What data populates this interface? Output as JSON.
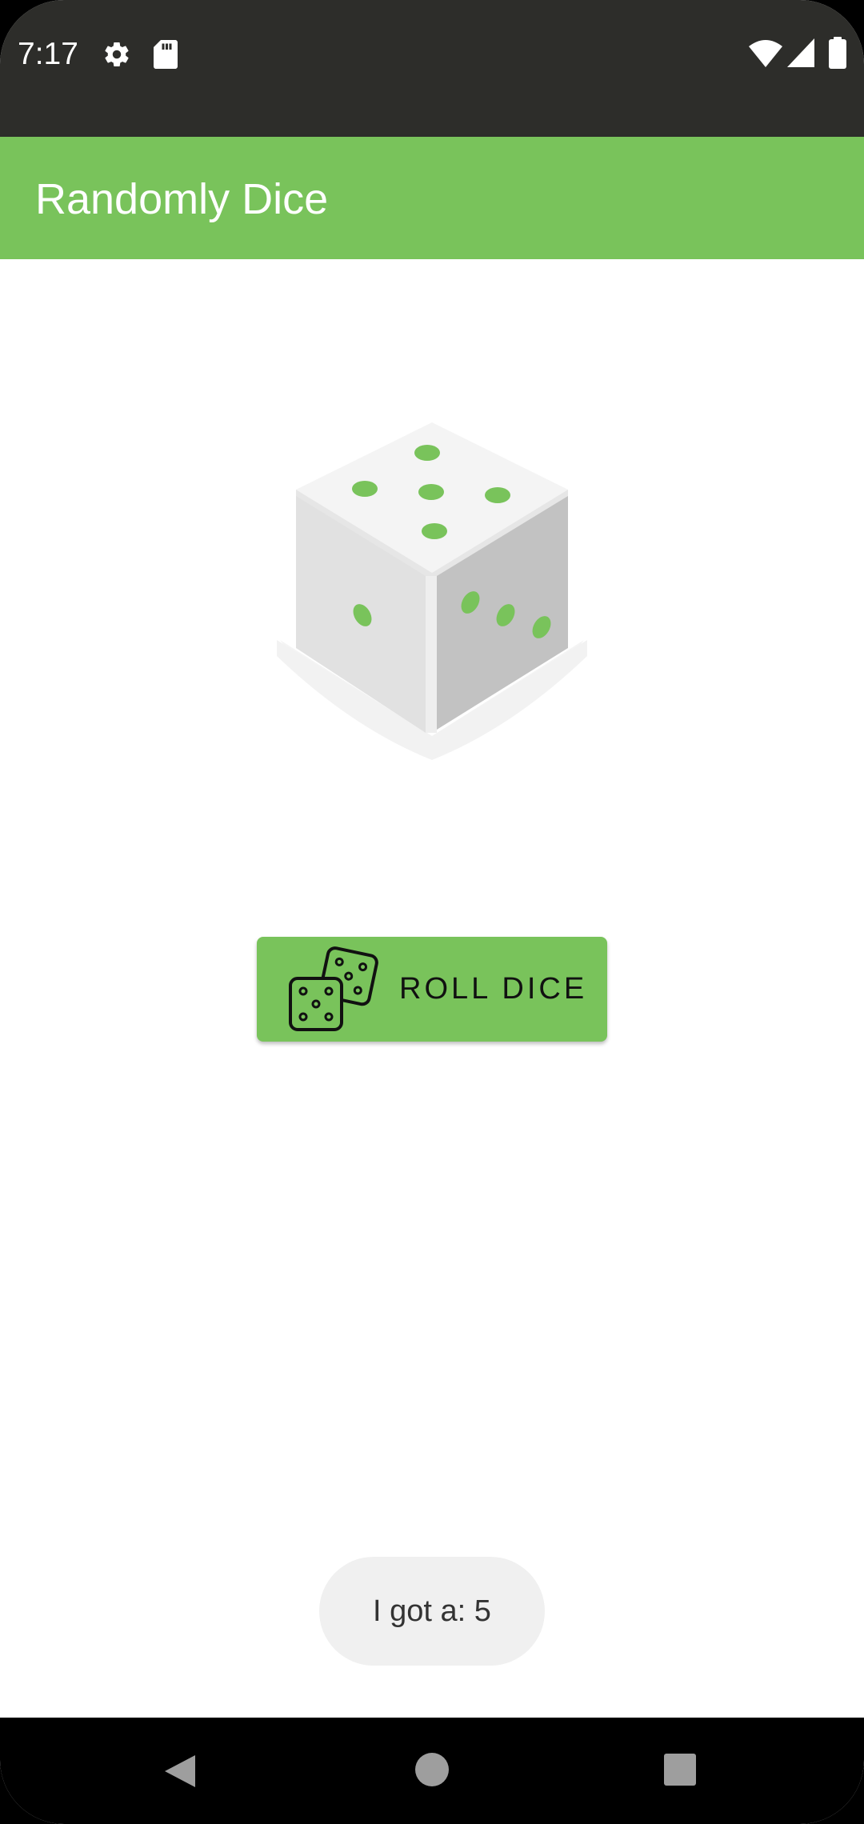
{
  "status_bar": {
    "time": "7:17",
    "icons": [
      "gear-icon",
      "sd-card-icon",
      "wifi-icon",
      "cell-signal-icon",
      "battery-icon"
    ],
    "background": "#2d2d2a"
  },
  "app_bar": {
    "title": "Randomly Dice",
    "color": "#79c35b"
  },
  "dice": {
    "icon": "dice-cube-icon",
    "accent": "#79c35b"
  },
  "roll_button": {
    "label": "ROLL DICE",
    "icon": "two-dice-icon",
    "color": "#79c35b"
  },
  "toast": {
    "text": "I got a: 5"
  },
  "nav_bar": {
    "buttons": [
      "back-icon",
      "home-icon",
      "recents-icon"
    ]
  }
}
